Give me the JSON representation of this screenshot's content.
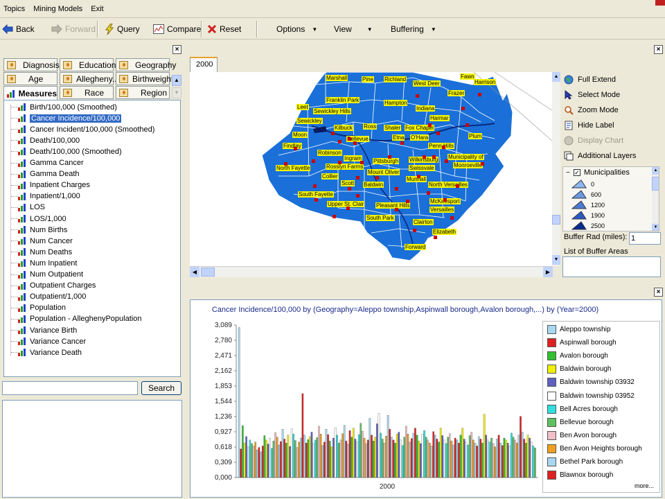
{
  "menubar": {
    "items": [
      "Topics",
      "Mining Models",
      "Exit"
    ]
  },
  "toolbar": {
    "back": "Back",
    "forward": "Forward",
    "query": "Query",
    "compare": "Compare",
    "reset": "Reset",
    "options": "Options",
    "view": "View",
    "buffering": "Buffering"
  },
  "left_panel": {
    "close": "×",
    "tabs_row1": [
      "Diagnosis",
      "Education",
      "Geography"
    ],
    "tabs_row2": [
      "Age",
      "Allegheny...",
      "Birthweight"
    ],
    "tabs_row3": [
      "Measures",
      "Race",
      "Region"
    ],
    "measures": [
      "Birth/100,000 (Smoothed)",
      "Cancer Incidence/100,000",
      "Cancer Incident/100,000 (Smoothed)",
      "Death/100,000",
      "Death/100,000 (Smoothed)",
      "Gamma Cancer",
      "Gamma Death",
      "Inpatient Charges",
      "Inpatient/1,000",
      "LOS",
      "LOS/1,000",
      "Num Births",
      "Num Cancer",
      "Num Deaths",
      "Num Inpatient",
      "Num Outpatient",
      "Outpatient Charges",
      "Outpatient/1,000",
      "Population",
      "Population - AlleghenyPopulation",
      "Variance Birth",
      "Variance Cancer",
      "Variance Death"
    ],
    "selected_index": 1,
    "search_value": "",
    "search_button": "Search"
  },
  "map_panel": {
    "close": "×",
    "tab": "2000",
    "labels": [
      "Marshall",
      "Pine",
      "Richland",
      "Fawn",
      "Harrison",
      "West Deer",
      "Franklin Park",
      "Hampton",
      "Frazer",
      "Leet",
      "Sewickley Hills",
      "Indiana",
      "Sewickley",
      "Harmar",
      "Kilbuck",
      "Ross",
      "Shaler",
      "Fox Chapel",
      "Moon",
      "Bellevue",
      "Etna",
      "O'Hara",
      "Plum",
      "Findlay",
      "Robinson",
      "Ingram",
      "Penn Hills",
      "Pittsburgh",
      "Wilkinsburg",
      "Municipality of",
      "North Fayette",
      "Rosslyn Farms",
      "Mount Oliver",
      "Swissvale",
      "Monroeville",
      "Collier",
      "Munhall",
      "Scott",
      "Baldwin",
      "North Versailles",
      "South Fayette",
      "Upper St. Clair",
      "McKeesport",
      "Pleasant Hills",
      "Versailles",
      "South Park",
      "Clairton",
      "Elizabeth",
      "Forward"
    ],
    "tools": [
      "Full Extend",
      "Select Mode",
      "Zoom Mode",
      "Hide Label",
      "Display Chart",
      "Additional Layers"
    ],
    "layer_name": "Municipalities",
    "layer_legend": [
      "0",
      "600",
      "1200",
      "1900",
      "2500"
    ],
    "buffer_label": "Buffer Rad (miles):",
    "buffer_value": "1",
    "buffer_list_label": "List of Buffer Areas"
  },
  "chart_panel": {
    "close": "×",
    "more": "more..."
  },
  "chart_data": {
    "type": "bar",
    "title": "Cancer Incidence/100,000 by (Geography=Aleppo township,Aspinwall borough,Avalon borough,...) by (Year=2000)",
    "xlabel": "",
    "ylabel": "",
    "categories": [
      "2000"
    ],
    "yticks": [
      "3,089",
      "2,780",
      "2,471",
      "2,162",
      "1,853",
      "1,544",
      "1,236",
      "0,927",
      "0,618",
      "0,309",
      "0,000"
    ],
    "ylim": [
      0,
      3089
    ],
    "legend_position": "right",
    "series": [
      {
        "name": "Aleppo township",
        "color": "#a8d8f0",
        "value": 3040
      },
      {
        "name": "Aspinwall borough",
        "color": "#e02020",
        "value": 580
      },
      {
        "name": "Avalon borough",
        "color": "#30c030",
        "value": 1050
      },
      {
        "name": "Baldwin borough",
        "color": "#f0f000",
        "value": 700
      },
      {
        "name": "Baldwin township 03932",
        "color": "#6060c0",
        "value": 830
      },
      {
        "name": "Baldwin township 03952",
        "color": "#ffffff",
        "value": 620
      },
      {
        "name": "Bell Acres borough",
        "color": "#30e0e0",
        "value": 760
      },
      {
        "name": "Bellevue borough",
        "color": "#60c060",
        "value": 690
      },
      {
        "name": "Ben Avon borough",
        "color": "#f0c0c8",
        "value": 640
      },
      {
        "name": "Ben Avon Heights borough",
        "color": "#f0a020",
        "value": 720
      },
      {
        "name": "Bethel Park borough",
        "color": "#a8d8f0",
        "value": 560
      },
      {
        "name": "Blawnox borough",
        "color": "#e02020",
        "value": 610
      }
    ],
    "other_values": [
      520,
      640,
      850,
      760,
      680,
      800,
      590,
      740,
      910,
      820,
      660,
      730,
      980,
      780,
      700,
      860,
      630,
      990,
      880,
      750,
      610,
      720,
      800,
      1700,
      860,
      700,
      770,
      830,
      920,
      690,
      760,
      810,
      1040,
      880,
      650,
      720,
      980,
      870,
      740,
      620,
      800,
      1010,
      860,
      700,
      760,
      890,
      1060,
      740,
      680,
      950,
      820,
      1000,
      780,
      720,
      870,
      1100,
      940,
      800,
      690,
      760,
      1200,
      860,
      740,
      820,
      1090,
      1300,
      900,
      780,
      700,
      840,
      1260,
      980,
      820,
      760,
      700,
      880,
      920,
      760,
      650,
      820,
      1040,
      880,
      720,
      790,
      900,
      1000,
      860,
      740,
      690,
      880,
      950,
      820,
      760,
      700,
      640,
      930,
      860,
      780,
      720,
      1000,
      850,
      760,
      690,
      820,
      890,
      740,
      660,
      800,
      760,
      700,
      860,
      1000,
      780,
      720,
      660,
      850,
      920,
      760,
      700,
      640,
      830,
      780,
      700,
      1280,
      860,
      760,
      720,
      800,
      690,
      620,
      780,
      860,
      700,
      650,
      800,
      760,
      700,
      640,
      900,
      820,
      760,
      700,
      860,
      1240,
      920,
      780,
      700,
      860,
      800,
      720,
      640,
      600
    ]
  }
}
